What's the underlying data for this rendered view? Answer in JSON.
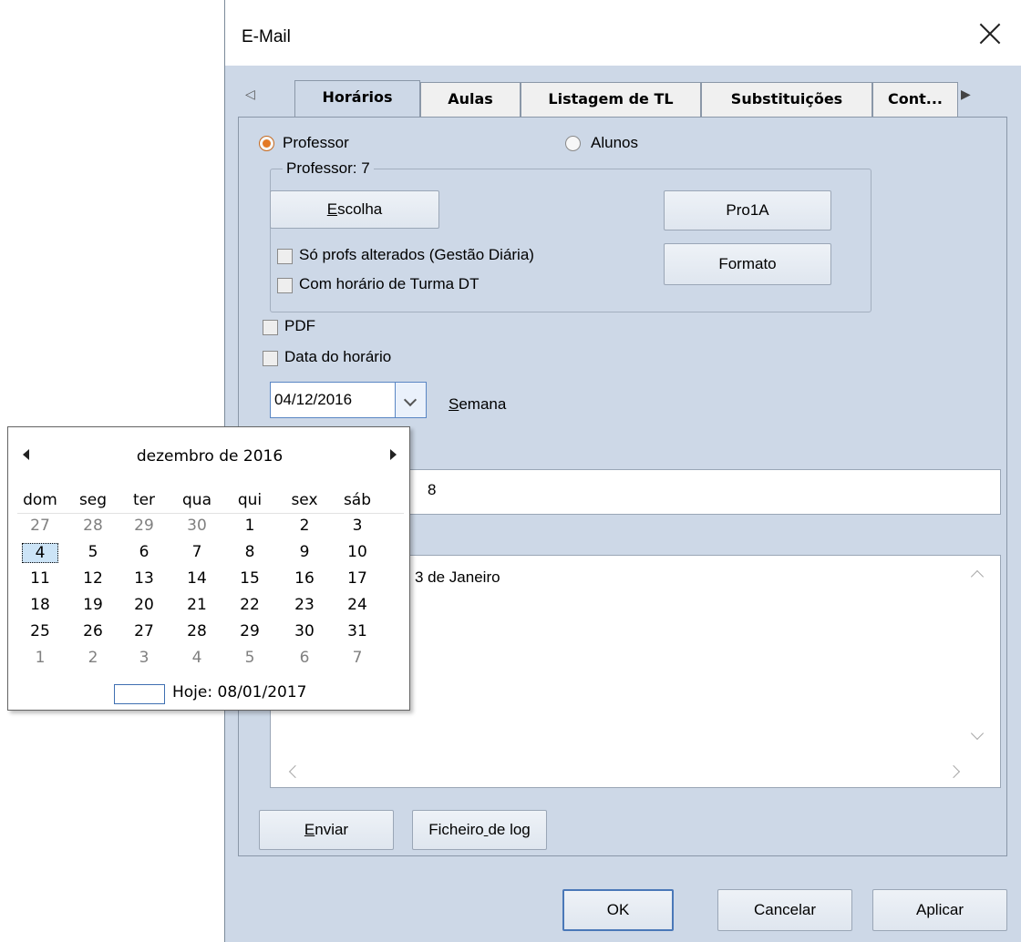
{
  "window": {
    "title": "E-Mail"
  },
  "tabs": [
    "Horários",
    "Aulas",
    "Listagem de TL",
    "Substituições",
    "Cont..."
  ],
  "radios": {
    "professor": "Professor",
    "alunos": "Alunos"
  },
  "group": {
    "legend": "Professor: 7",
    "escolha": {
      "pre": "",
      "ul": "E",
      "post": "scolha"
    },
    "pro1a": "Pro1A",
    "formato": "Formato",
    "chk_alterados": "Só profs alterados (Gestão Diária)",
    "chk_turma": "Com horário de Turma DT"
  },
  "chk_pdf": "PDF",
  "chk_data": "Data do horário",
  "date_value": "04/12/2016",
  "semana": {
    "ul": "S",
    "post": "emana"
  },
  "field_value": "8",
  "textarea_value": "3 de Janeiro",
  "buttons": {
    "enviar": {
      "ul": "E",
      "post": "nviar"
    },
    "log": {
      "pre": "Ficheiro",
      "ul": " ",
      "post": "de log"
    },
    "ok": "OK",
    "cancelar": "Cancelar",
    "aplicar": "Aplicar"
  },
  "calendar": {
    "month": "dezembro de 2016",
    "weekdays": [
      "dom",
      "seg",
      "ter",
      "qua",
      "qui",
      "sex",
      "sáb"
    ],
    "weeks": [
      [
        "27",
        "28",
        "29",
        "30",
        "1",
        "2",
        "3"
      ],
      [
        "4",
        "5",
        "6",
        "7",
        "8",
        "9",
        "10"
      ],
      [
        "11",
        "12",
        "13",
        "14",
        "15",
        "16",
        "17"
      ],
      [
        "18",
        "19",
        "20",
        "21",
        "22",
        "23",
        "24"
      ],
      [
        "25",
        "26",
        "27",
        "28",
        "29",
        "30",
        "31"
      ],
      [
        "1",
        "2",
        "3",
        "4",
        "5",
        "6",
        "7"
      ]
    ],
    "other_month": [
      [
        0,
        0
      ],
      [
        0,
        1
      ],
      [
        0,
        2
      ],
      [
        0,
        3
      ],
      [
        5,
        0
      ],
      [
        5,
        1
      ],
      [
        5,
        2
      ],
      [
        5,
        3
      ],
      [
        5,
        4
      ],
      [
        5,
        5
      ],
      [
        5,
        6
      ]
    ],
    "selected": [
      1,
      0
    ],
    "today": "Hoje: 08/01/2017"
  }
}
